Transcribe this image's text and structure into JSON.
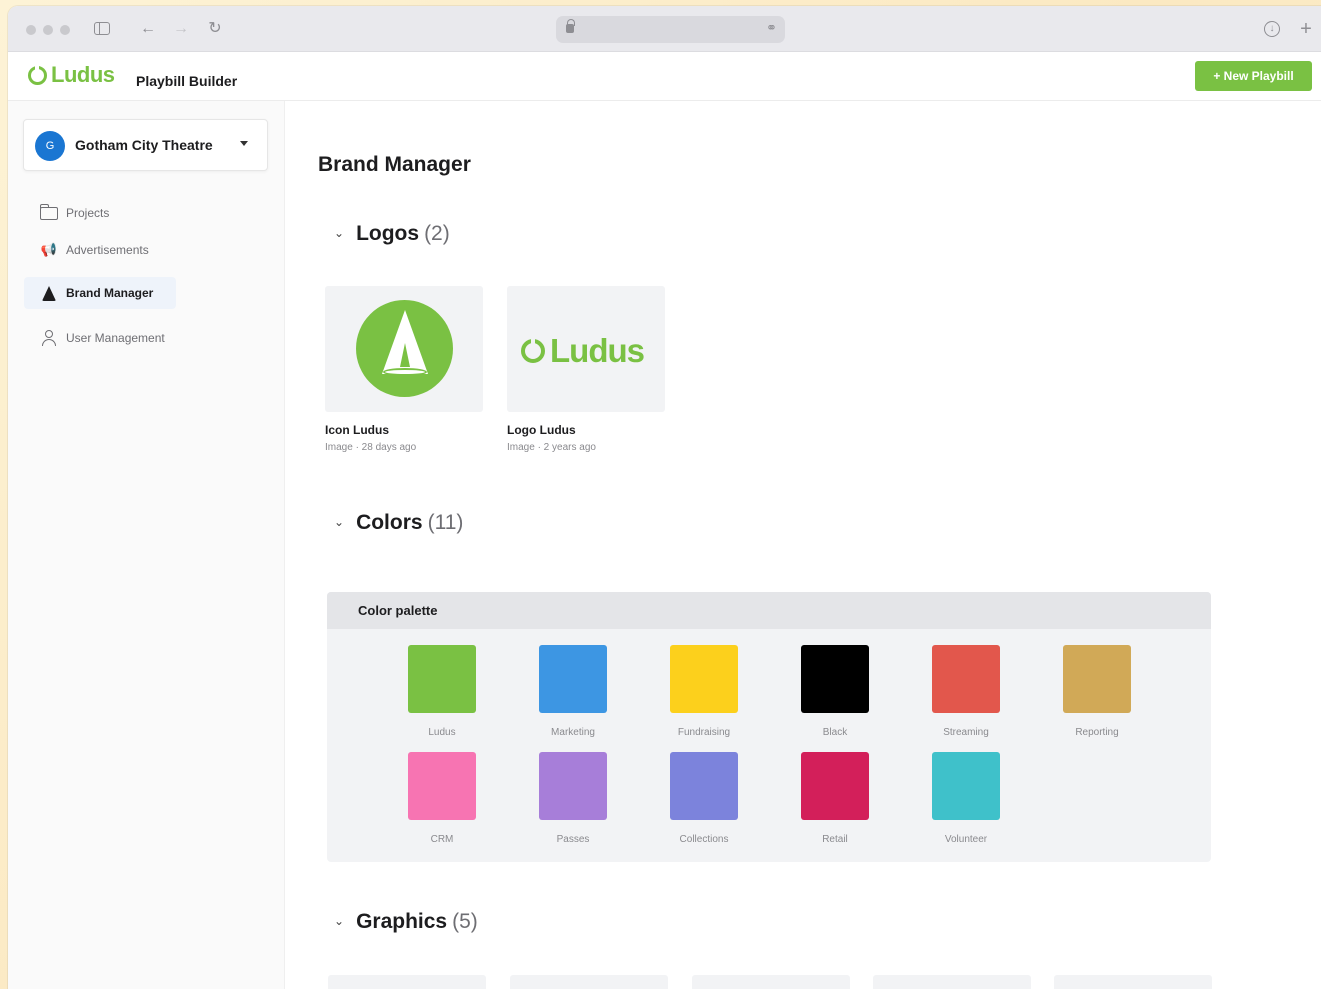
{
  "browser": {
    "back": "←",
    "forward": "→",
    "reload": "↻",
    "newtab": "+",
    "link": "⚭"
  },
  "app": {
    "brand": "Ludus",
    "product": "Playbill Builder",
    "new_button": "+ New Playbill",
    "accent": "#7ac143"
  },
  "sidebar": {
    "org": {
      "initial": "G",
      "name": "Gotham City Theatre"
    },
    "items": [
      {
        "label": "Projects",
        "icon": "folder-icon"
      },
      {
        "label": "Advertisements",
        "icon": "megaphone-icon"
      },
      {
        "label": "Brand Manager",
        "icon": "cone-icon",
        "active": true
      },
      {
        "label": "User Management",
        "icon": "user-icon"
      }
    ]
  },
  "main": {
    "title": "Brand Manager",
    "sections": {
      "logos": {
        "name": "Logos",
        "count": "(2)"
      },
      "colors": {
        "name": "Colors",
        "count": "(11)"
      },
      "graphics": {
        "name": "Graphics",
        "count": "(5)"
      }
    },
    "logos": [
      {
        "name": "Icon Ludus",
        "meta": "Image · 28 days ago"
      },
      {
        "name": "Logo Ludus",
        "meta": "Image · 2 years ago",
        "wordmark": "Ludus"
      }
    ],
    "palette": {
      "title": "Color palette",
      "colors": [
        {
          "label": "Ludus",
          "hex": "#7ac143"
        },
        {
          "label": "Marketing",
          "hex": "#3d96e3"
        },
        {
          "label": "Fundraising",
          "hex": "#fcd01c"
        },
        {
          "label": "Black",
          "hex": "#000000"
        },
        {
          "label": "Streaming",
          "hex": "#e2574c"
        },
        {
          "label": "Reporting",
          "hex": "#d1a957"
        },
        {
          "label": "CRM",
          "hex": "#f774b2"
        },
        {
          "label": "Passes",
          "hex": "#a77ed9"
        },
        {
          "label": "Collections",
          "hex": "#7c83dc"
        },
        {
          "label": "Retail",
          "hex": "#d31f5a"
        },
        {
          "label": "Volunteer",
          "hex": "#3fc1ca"
        }
      ]
    }
  }
}
